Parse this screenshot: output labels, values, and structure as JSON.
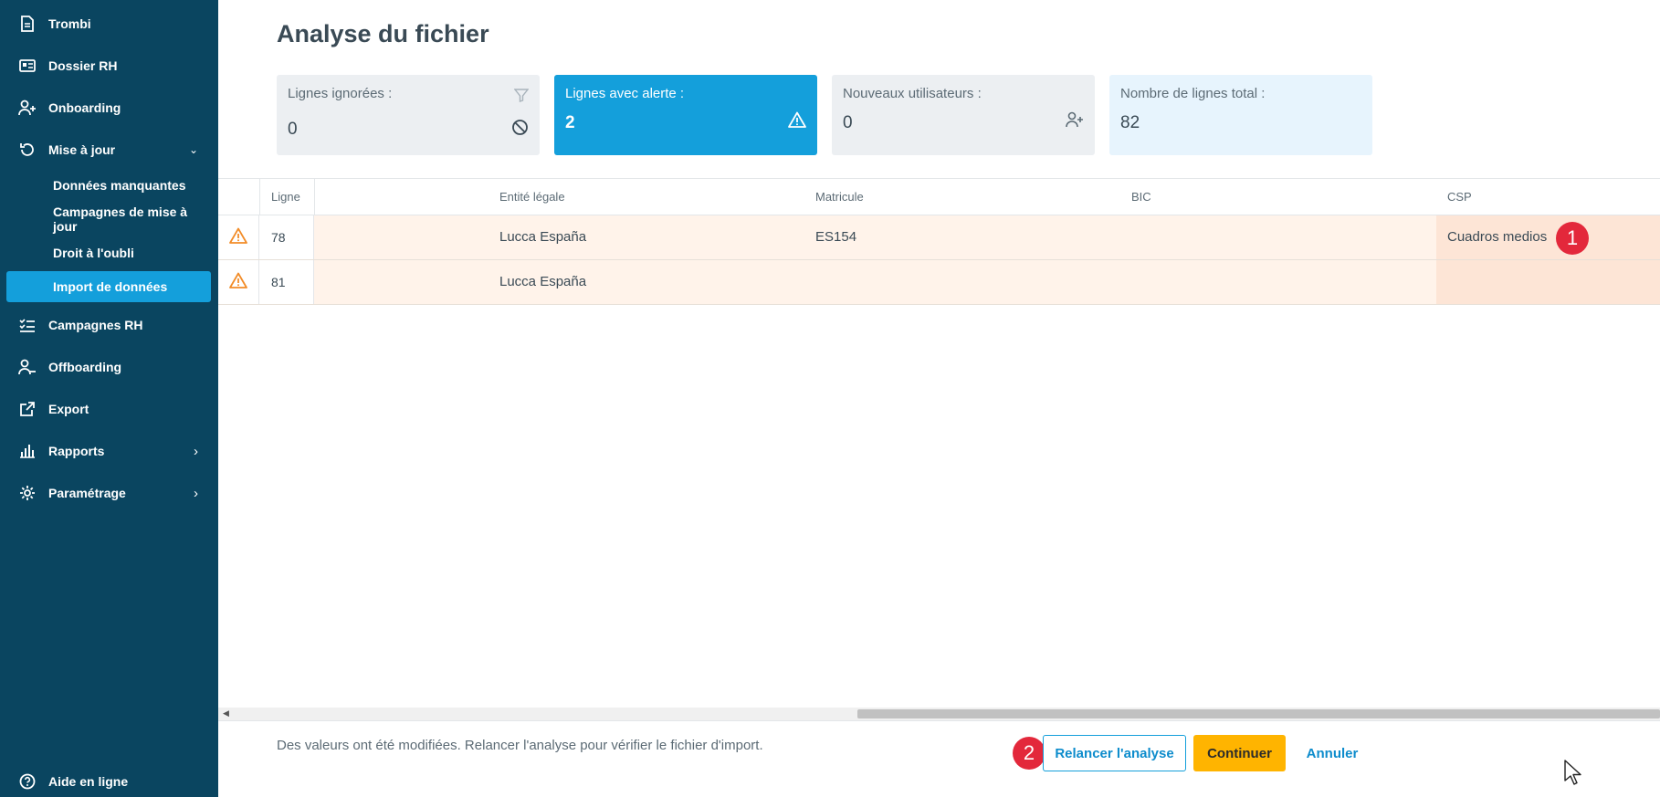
{
  "sidebar": {
    "items": [
      {
        "label": "Trombi",
        "icon": "document-icon"
      },
      {
        "label": "Dossier RH",
        "icon": "id-card-icon"
      },
      {
        "label": "Onboarding",
        "icon": "user-add-icon"
      },
      {
        "label": "Mise à jour",
        "icon": "refresh-icon",
        "chevron": "⌄"
      },
      {
        "label": "Campagnes RH",
        "icon": "checklist-icon"
      },
      {
        "label": "Offboarding",
        "icon": "user-remove-icon"
      },
      {
        "label": "Export",
        "icon": "external-link-icon"
      },
      {
        "label": "Rapports",
        "icon": "bar-chart-icon",
        "chevron": "›"
      },
      {
        "label": "Paramétrage",
        "icon": "gear-icon",
        "chevron": "›"
      }
    ],
    "subitems": [
      {
        "label": "Données manquantes"
      },
      {
        "label": "Campagnes de mise à jour"
      },
      {
        "label": "Droit à l'oubli"
      },
      {
        "label": "Import de données",
        "active": true
      }
    ],
    "help": {
      "label": "Aide en ligne",
      "icon": "help-circle-icon"
    }
  },
  "main": {
    "title": "Analyse du fichier",
    "cards": [
      {
        "title": "Lignes ignorées :",
        "value": "0",
        "icon": "filter-icon",
        "icon2": "blocked-icon"
      },
      {
        "title": "Lignes avec alerte :",
        "value": "2",
        "icon": "warning-icon"
      },
      {
        "title": "Nouveaux utilisateurs :",
        "value": "0",
        "icon": "user-add-icon"
      },
      {
        "title": "Nombre de lignes total :",
        "value": "82"
      }
    ],
    "table": {
      "headers": {
        "ligne": "Ligne",
        "entite": "Entité légale",
        "matricule": "Matricule",
        "bic": "BIC",
        "csp": "CSP"
      },
      "rows": [
        {
          "ligne": "78",
          "entite": "Lucca España",
          "matricule": "ES154",
          "bic": "",
          "csp": "Cuadros medios"
        },
        {
          "ligne": "81",
          "entite": "Lucca España",
          "matricule": "",
          "bic": "",
          "csp": ""
        }
      ]
    },
    "badges": [
      "1",
      "2"
    ]
  },
  "footer": {
    "message": "Des valeurs ont été modifiées. Relancer l'analyse pour vérifier le fichier d'import.",
    "relaunch_label": "Relancer l'analyse",
    "continue_label": "Continuer",
    "cancel_label": "Annuler"
  },
  "colors": {
    "sidebar_bg": "#0a4560",
    "accent": "#149fdb",
    "warning": "#f28c28",
    "primary_button": "#ffb400",
    "badge": "#e3283b",
    "row_alert_bg": "#fff3ea"
  }
}
